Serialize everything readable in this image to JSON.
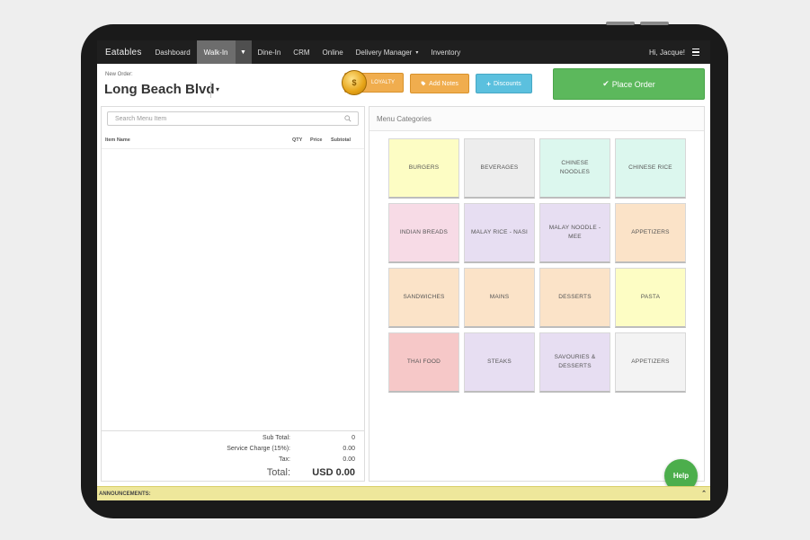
{
  "navbar": {
    "brand": "Eatables",
    "items": [
      "Dashboard",
      "Walk-In",
      "Dine-In",
      "CRM",
      "Online",
      "Delivery Manager",
      "Inventory"
    ],
    "greeting": "Hi, Jacque!"
  },
  "order": {
    "label": "New Order:",
    "location": "Long Beach Blvd",
    "loyalty_label": "LOYALTY",
    "add_notes_label": "Add Notes",
    "discounts_label": "Discounts",
    "place_order_label": "Place Order"
  },
  "left": {
    "search_placeholder": "Search Menu Item",
    "columns": {
      "item": "Item Name",
      "qty": "QTY",
      "price": "Price",
      "subtotal": "Subtotal"
    },
    "totals": {
      "sub_total_label": "Sub Total:",
      "sub_total_value": "0",
      "service_label": "Service Charge (15%):",
      "service_value": "0.00",
      "tax_label": "Tax:",
      "tax_value": "0.00",
      "total_label": "Total:",
      "total_value": "USD 0.00"
    }
  },
  "menu": {
    "heading": "Menu Categories",
    "categories": [
      {
        "label": "BURGERS",
        "color": "#fdfdc4"
      },
      {
        "label": "BEVERAGES",
        "color": "#ededed"
      },
      {
        "label": "CHINESE NOODLES",
        "color": "#dcf7ee"
      },
      {
        "label": "CHINESE RICE",
        "color": "#dcf7ee"
      },
      {
        "label": "INDIAN BREADS",
        "color": "#f7dbe6"
      },
      {
        "label": "MALAY RICE - NASI",
        "color": "#e7def2"
      },
      {
        "label": "MALAY NOODLE - MEE",
        "color": "#e7def2"
      },
      {
        "label": "APPETIZERS",
        "color": "#fbe3c8"
      },
      {
        "label": "SANDWICHES",
        "color": "#fbe3c8"
      },
      {
        "label": "MAINS",
        "color": "#fbe3c8"
      },
      {
        "label": "DESSERTS",
        "color": "#fbe3c8"
      },
      {
        "label": "PASTA",
        "color": "#fdfdc4"
      },
      {
        "label": "THAI FOOD",
        "color": "#f6c8c8"
      },
      {
        "label": "STEAKS",
        "color": "#e7def2"
      },
      {
        "label": "SAVOURIES & DESSERTS",
        "color": "#e7def2"
      },
      {
        "label": "APPETIZERS",
        "color": "#f3f3f3"
      }
    ]
  },
  "help_label": "Help",
  "announcements_label": "ANNOUNCEMENTS:"
}
